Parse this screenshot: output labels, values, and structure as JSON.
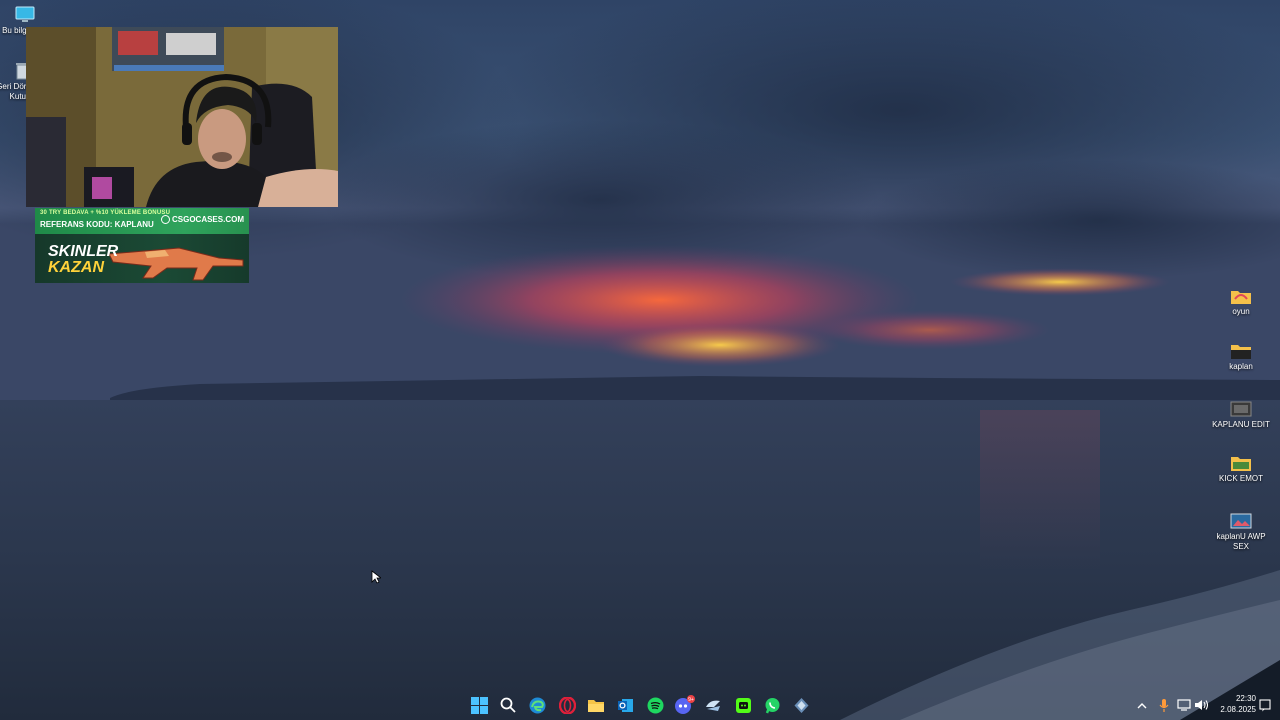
{
  "desktop_left": [
    {
      "label": "Bu bilgisayar",
      "icon": "monitor-icon"
    },
    {
      "label": "Geri Dönüşüm Kutusu",
      "icon": "recycle-bin-icon"
    }
  ],
  "desktop_right": [
    {
      "label": "oyun",
      "icon": "folder-icon"
    },
    {
      "label": "kaplan",
      "icon": "folder-icon"
    },
    {
      "label": "KAPLANU EDIT",
      "icon": "video-file-icon"
    },
    {
      "label": "KICK EMOT",
      "icon": "folder-icon"
    },
    {
      "label": "kaplanU AWP SEX",
      "icon": "image-file-icon"
    }
  ],
  "stream_overlay": {
    "promo_line1": "30 TRY BEDAVA + %10 YÜKLEME BONUSU",
    "promo_line2": "REFERANS KODU: KAPLANU",
    "promo_brand": "CSGOCASES.COM",
    "promo_headline_1": "SKINLER",
    "promo_headline_2": "KAZAN",
    "webcam_label": "webcam-feed"
  },
  "taskbar": {
    "apps": [
      {
        "name": "start",
        "icon": "windows-start-icon"
      },
      {
        "name": "search",
        "icon": "search-icon"
      },
      {
        "name": "edge",
        "icon": "edge-icon"
      },
      {
        "name": "opera",
        "icon": "opera-icon"
      },
      {
        "name": "explorer",
        "icon": "folder-icon"
      },
      {
        "name": "outlook",
        "icon": "outlook-icon"
      },
      {
        "name": "spotify",
        "icon": "spotify-icon"
      },
      {
        "name": "discord",
        "icon": "discord-icon",
        "badge": "9+"
      },
      {
        "name": "steam",
        "icon": "steam-icon"
      },
      {
        "name": "kick",
        "icon": "kick-icon"
      },
      {
        "name": "whatsapp",
        "icon": "whatsapp-icon"
      },
      {
        "name": "app",
        "icon": "app-icon"
      }
    ],
    "time": "22:30",
    "date": "2.08.2025"
  }
}
